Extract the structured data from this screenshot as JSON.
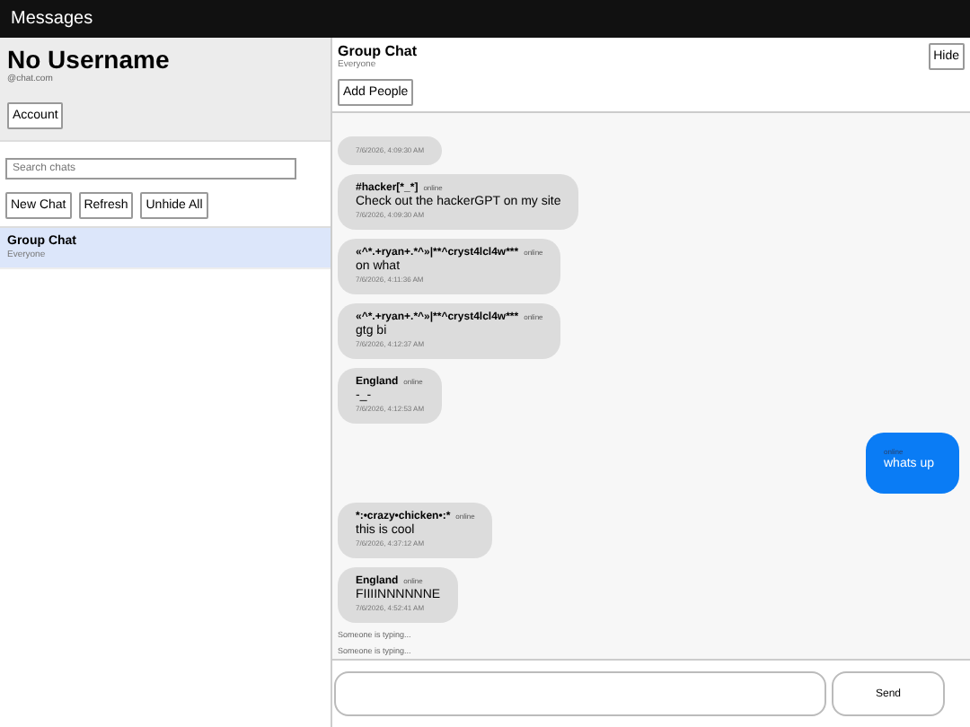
{
  "app_bar": {
    "title": "Messages"
  },
  "profile": {
    "username": "No Username",
    "email": "@chat.com",
    "account_button": "Account"
  },
  "search": {
    "placeholder": "Search chats"
  },
  "sidebar_buttons": [
    "New Chat",
    "Refresh",
    "Unhide All"
  ],
  "chats": [
    {
      "name": "Group Chat",
      "subtitle": "Everyone",
      "selected": true
    }
  ],
  "chat_header": {
    "title": "Group Chat",
    "subtitle": "Everyone",
    "add_button": "Add People",
    "hide_button": "Hide"
  },
  "messages": [
    {
      "kind": "incoming",
      "time": "7/6/2026, 4:09:30 AM"
    },
    {
      "kind": "incoming",
      "sender": "#hacker[*_*]",
      "status": "online",
      "text": "Check out the hackerGPT on my site",
      "time": "7/6/2026, 4:09:30 AM"
    },
    {
      "kind": "incoming",
      "sender": "«^*.+ryan+.*^»|**^cryst4lcl4w***",
      "status": "online",
      "text": "on what",
      "time": "7/6/2026, 4:11:36 AM"
    },
    {
      "kind": "incoming",
      "sender": "«^*.+ryan+.*^»|**^cryst4lcl4w***",
      "status": "online",
      "text": "gtg bi",
      "time": "7/6/2026, 4:12:37 AM"
    },
    {
      "kind": "incoming",
      "sender": "England",
      "status": "online",
      "text": "-_-",
      "time": "7/6/2026, 4:12:53 AM"
    },
    {
      "kind": "outgoing",
      "status": "online",
      "text": "whats up"
    },
    {
      "kind": "incoming",
      "sender": "*:•crazy•chicken•:*",
      "status": "online",
      "text": "this is cool",
      "time": "7/6/2026, 4:37:12 AM"
    },
    {
      "kind": "incoming",
      "sender": "England",
      "status": "online",
      "text": "FIIIINNNNNNE",
      "time": "7/6/2026, 4:52:41 AM"
    }
  ],
  "typing": [
    "Someone is typing...",
    "Someone is typing..."
  ],
  "composer": {
    "send_button": "Send"
  }
}
